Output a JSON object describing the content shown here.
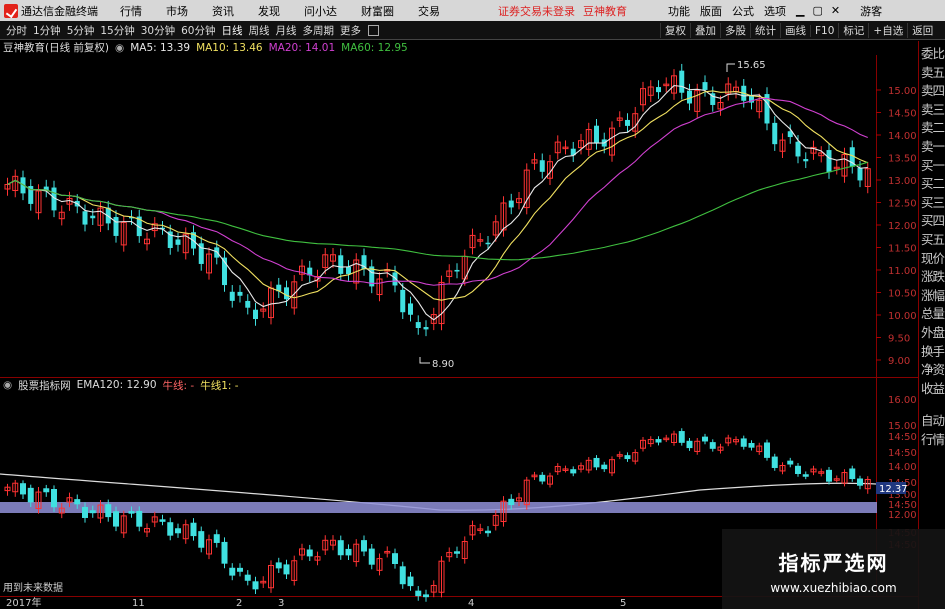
{
  "menubar": {
    "app_title": "通达信金融终端",
    "items": [
      "行情",
      "市场",
      "资讯",
      "发现",
      "问小达",
      "财富圈",
      "交易"
    ],
    "notice": "证券交易未登录",
    "account": "豆神教育",
    "right_items": [
      "功能",
      "版面",
      "公式",
      "选项"
    ],
    "guest": "游客"
  },
  "toolbar": {
    "periods": [
      "分时",
      "1分钟",
      "5分钟",
      "15分钟",
      "30分钟",
      "60分钟",
      "日线",
      "周线",
      "月线",
      "多周期",
      "更多"
    ],
    "selected": "日线",
    "right_items": [
      "复权",
      "叠加",
      "多股",
      "统计",
      "画线",
      "F10",
      "标记",
      "+自选",
      "返回"
    ]
  },
  "main_header": {
    "stock": "豆神教育(日线 前复权)",
    "ma5": "MA5: 13.39",
    "ma10": "MA10: 13.46",
    "ma20": "MA20: 14.01",
    "ma60": "MA60: 12.95"
  },
  "sub_header": {
    "name": "股票指标网",
    "ema": "EMA120: 12.90",
    "bull1": "牛线: -",
    "bull2": "牛线1: -"
  },
  "price_axis": [
    "15.00",
    "14.50",
    "14.00",
    "13.50",
    "13.00",
    "12.50",
    "12.00",
    "11.50",
    "11.00",
    "10.50",
    "10.00",
    "9.50",
    "9.00"
  ],
  "sub_axis": [
    "16.00",
    "15.00",
    "14:50",
    "14:50",
    "14.00",
    "14:50",
    "13.00",
    "14:50",
    "12.37",
    "12.00",
    "14:50",
    "14:50"
  ],
  "annotations": {
    "high": "15.65",
    "low": "8.90"
  },
  "future_text": "用到未来数据",
  "date_labels": [
    "2017年",
    "11",
    "2",
    "3",
    "4",
    "5"
  ],
  "sidebar": [
    "委比",
    "卖五",
    "卖四",
    "卖三",
    "卖二",
    "卖一",
    "买一",
    "买二",
    "买三",
    "买四",
    "买五",
    "现价",
    "涨跌",
    "涨幅",
    "总量",
    "外盘",
    "换手",
    "净资",
    "收益",
    "自动",
    "行情"
  ],
  "watermark": {
    "title": "指标严选网",
    "url": "www.xuezhibiao.com"
  },
  "colors": {
    "ma5": "#e8e8e8",
    "ma10": "#f0e060",
    "ma20": "#d040d0",
    "ma60": "#40c040",
    "up": "#ff3333",
    "down": "#40e0e0"
  }
}
